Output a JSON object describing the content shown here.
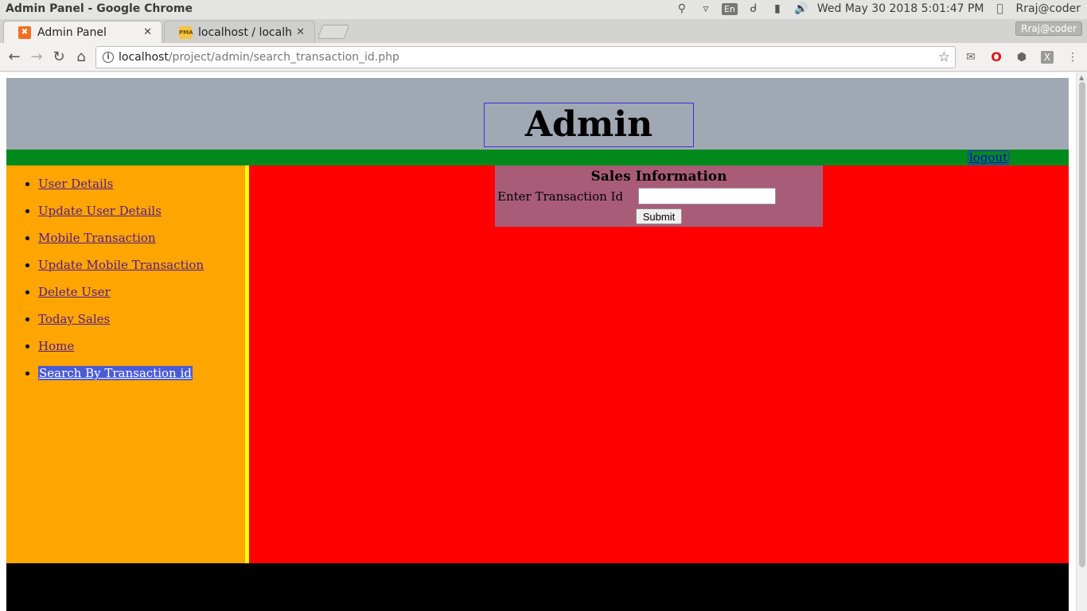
{
  "os": {
    "window_title": "Admin Panel - Google Chrome",
    "lang": "En",
    "datetime": "Wed May 30 2018  5:01:47 PM",
    "user": "Rraj@coder"
  },
  "tabs": [
    {
      "label": "Admin Panel",
      "close": "✕"
    },
    {
      "label": "localhost / localhos",
      "close": "✕"
    }
  ],
  "profile": "Rraj@coder",
  "address": {
    "host": "localhost",
    "path": "/project/admin/search_transaction_id.php"
  },
  "page": {
    "title": "Admin Panel",
    "logout": "logout",
    "nav": [
      "User Details",
      "Update User Details",
      "Mobile Transaction",
      "Update Mobile Transaction",
      "Delete User",
      "Today Sales",
      "Home",
      "Search By Transaction id"
    ],
    "form": {
      "title": "Sales Information",
      "label": "Enter Transaction Id",
      "input_value": "",
      "submit": "Submit"
    }
  },
  "colors": {
    "header_bg": "#a0a8b4",
    "bar_green": "#008a1c",
    "sidebar_orange": "#ffa500",
    "divider_yellow": "#ffff00",
    "main_red": "#ff0000",
    "form_bg": "#a85c78",
    "footer": "#000000"
  }
}
